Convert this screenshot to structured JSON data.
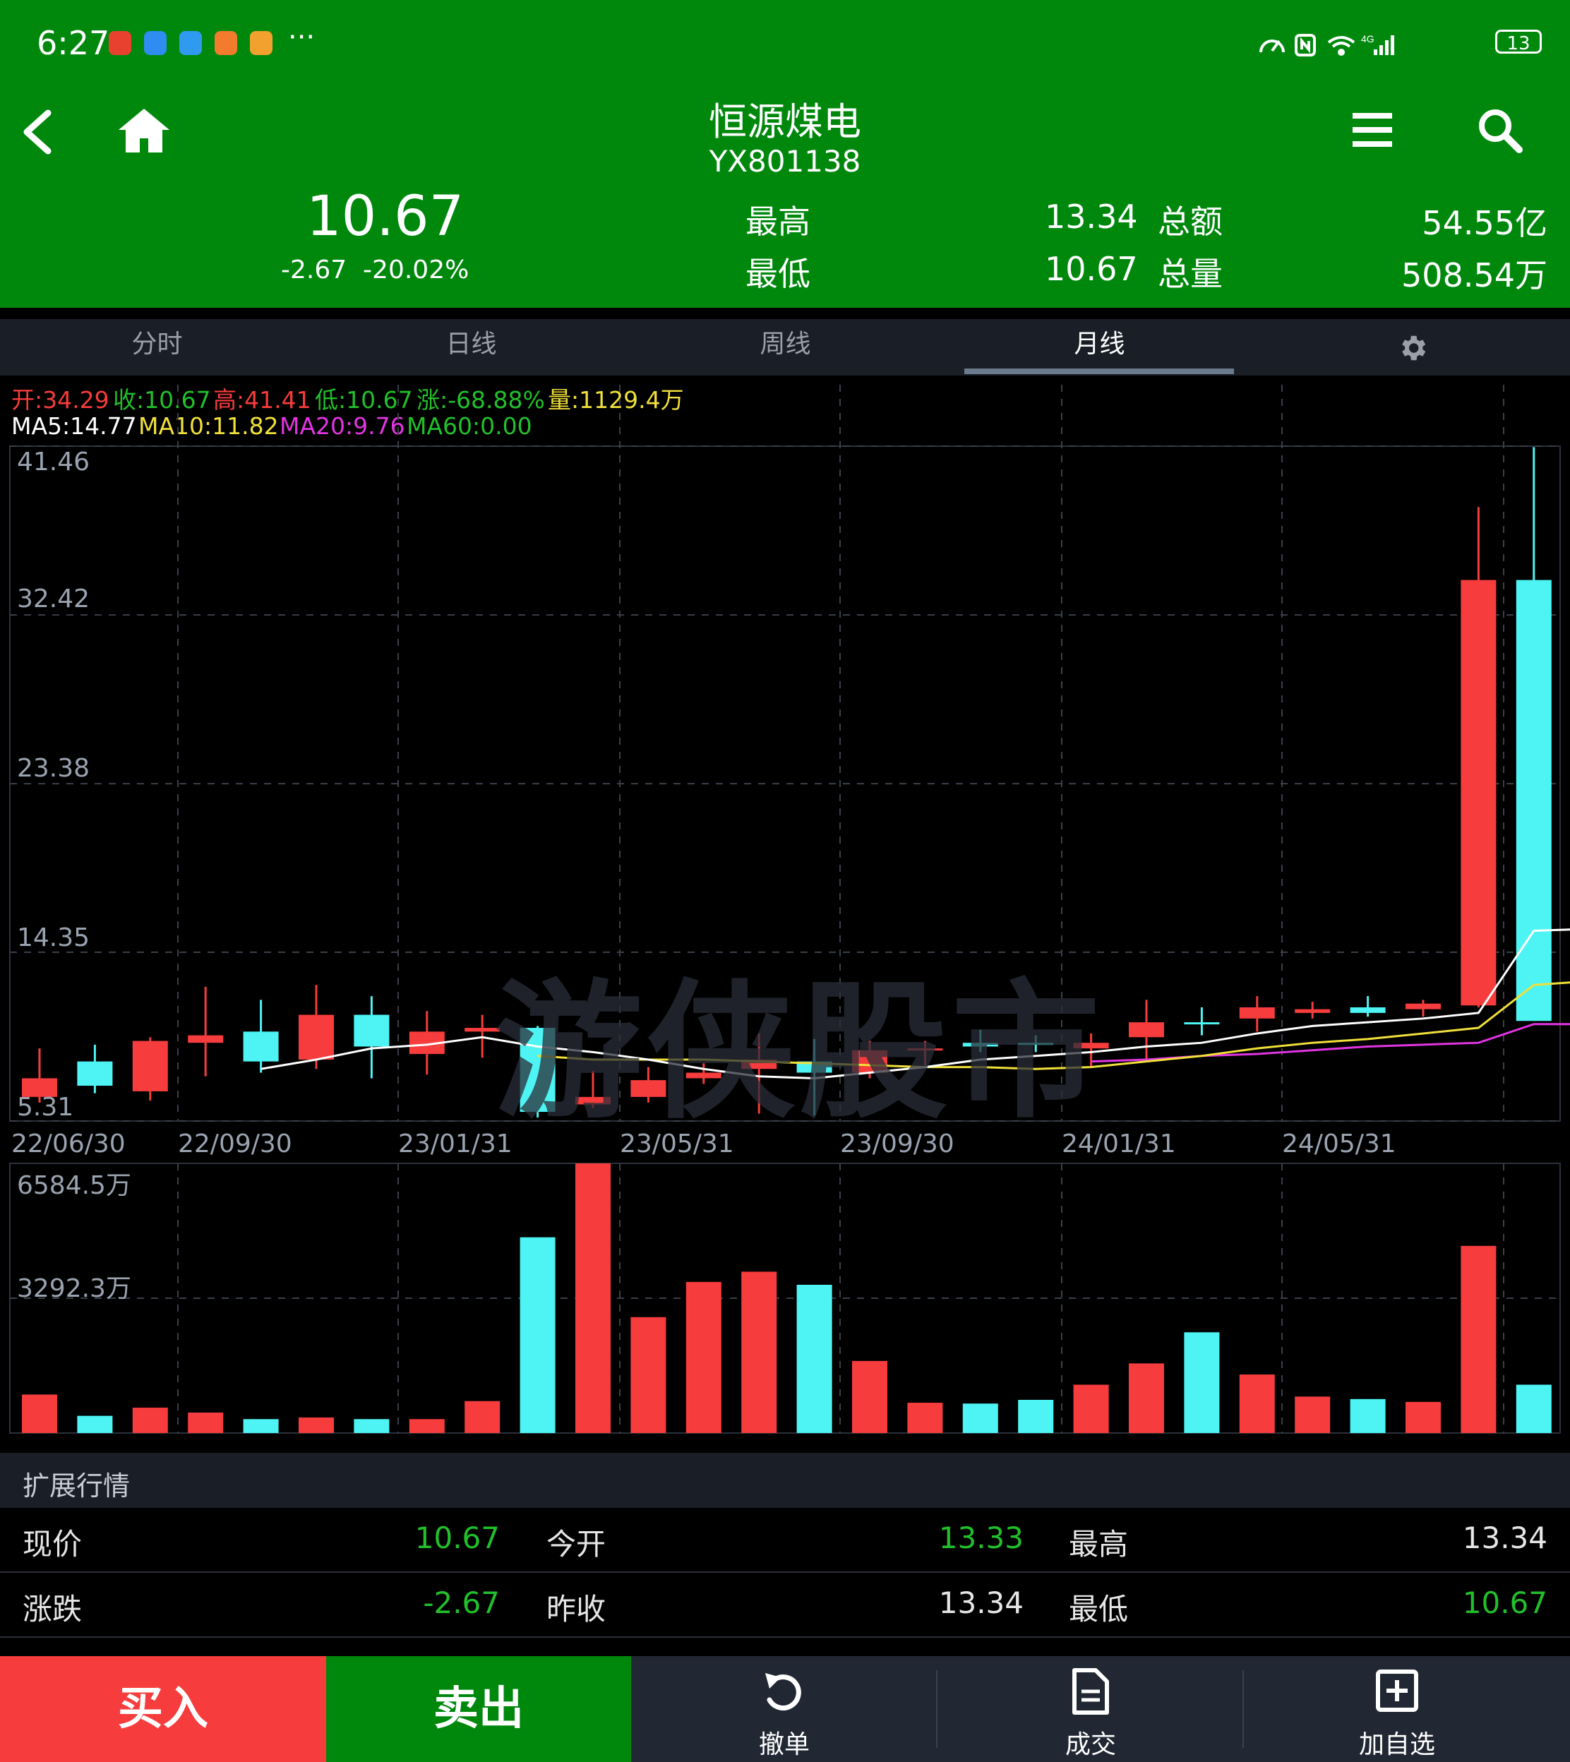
{
  "status_bar": {
    "time": "6:27",
    "more": "···",
    "network_label": "4G",
    "battery": "13"
  },
  "header": {
    "title": "恒源煤电",
    "code": "YX801138",
    "price": "10.67",
    "change": "-2.67",
    "change_pct": "-20.02%",
    "high_label": "最高",
    "high_value": "13.34",
    "low_label": "最低",
    "low_value": "10.67",
    "amount_label": "总额",
    "amount_value": "54.55亿",
    "volume_label": "总量",
    "volume_value": "508.54万"
  },
  "tabs": [
    "分时",
    "日线",
    "周线",
    "月线"
  ],
  "active_tab": "月线",
  "info": {
    "open": "开:34.29",
    "close": "收:10.67",
    "high": "高:41.41",
    "low": "低:10.67",
    "change": "涨:-68.88%",
    "volume": "量:1129.4万",
    "ma5": "MA5:14.77",
    "ma10": "MA10:11.82",
    "ma20": "MA20:9.76",
    "ma60": "MA60:0.00"
  },
  "watermark": "游侠股市",
  "colors": {
    "up": "#f63c3c",
    "down": "#4ef4f4",
    "ma5": "#ffffff",
    "ma10": "#f0e03a",
    "ma20": "#e235e2",
    "ma60": "#22c02a",
    "header_bg": "#00880d",
    "value_green": "#22c02a"
  },
  "chart_data": [
    {
      "type": "candlestick",
      "title": "",
      "period": "月线",
      "y_ticks": [
        "41.46",
        "32.42",
        "23.38",
        "14.35",
        "5.31"
      ],
      "ylim": [
        5.31,
        41.46
      ],
      "x_tick_labels": [
        "22/06/30",
        "22/09/30",
        "23/01/31",
        "23/05/31",
        "23/09/30",
        "24/01/31",
        "24/05/31"
      ],
      "candles": [
        {
          "o": 6.6,
          "c": 7.6,
          "h": 9.2,
          "l": 6.3
        },
        {
          "o": 8.5,
          "c": 7.2,
          "h": 9.4,
          "l": 6.8
        },
        {
          "o": 6.9,
          "c": 9.6,
          "h": 9.8,
          "l": 6.4
        },
        {
          "o": 9.5,
          "c": 9.9,
          "h": 12.5,
          "l": 7.7
        },
        {
          "o": 10.1,
          "c": 8.5,
          "h": 11.8,
          "l": 7.9
        },
        {
          "o": 8.6,
          "c": 11.0,
          "h": 12.6,
          "l": 8.1
        },
        {
          "o": 11.0,
          "c": 9.3,
          "h": 12.0,
          "l": 7.6
        },
        {
          "o": 8.9,
          "c": 10.1,
          "h": 11.2,
          "l": 7.8
        },
        {
          "o": 10.1,
          "c": 10.3,
          "h": 11.0,
          "l": 8.7
        },
        {
          "o": 10.3,
          "c": 5.8,
          "h": 10.4,
          "l": 5.5
        },
        {
          "o": 6.2,
          "c": 6.6,
          "h": 8.0,
          "l": 6.0
        },
        {
          "o": 6.6,
          "c": 7.5,
          "h": 8.2,
          "l": 6.3
        },
        {
          "o": 7.6,
          "c": 7.9,
          "h": 8.4,
          "l": 7.3
        },
        {
          "o": 8.1,
          "c": 8.6,
          "h": 10.0,
          "l": 5.7
        },
        {
          "o": 8.5,
          "c": 7.9,
          "h": 9.7,
          "l": 5.6
        },
        {
          "o": 7.9,
          "c": 9.1,
          "h": 9.6,
          "l": 7.6
        },
        {
          "o": 9.1,
          "c": 9.2,
          "h": 9.6,
          "l": 8.3
        },
        {
          "o": 9.5,
          "c": 9.3,
          "h": 10.2,
          "l": 9.0
        },
        {
          "o": 9.5,
          "c": 9.4,
          "h": 9.9,
          "l": 9.0
        },
        {
          "o": 9.2,
          "c": 9.5,
          "h": 10.0,
          "l": 8.2
        },
        {
          "o": 9.8,
          "c": 10.6,
          "h": 11.8,
          "l": 8.6
        },
        {
          "o": 10.6,
          "c": 10.5,
          "h": 11.4,
          "l": 9.9
        },
        {
          "o": 10.8,
          "c": 11.4,
          "h": 12.0,
          "l": 10.1
        },
        {
          "o": 11.1,
          "c": 11.3,
          "h": 11.7,
          "l": 10.8
        },
        {
          "o": 11.4,
          "c": 11.1,
          "h": 12.0,
          "l": 10.9
        },
        {
          "o": 11.3,
          "c": 11.6,
          "h": 11.8,
          "l": 10.9
        },
        {
          "o": 11.5,
          "c": 34.29,
          "h": 38.2,
          "l": 11.4
        },
        {
          "o": 34.29,
          "c": 10.67,
          "h": 41.41,
          "l": 10.67
        }
      ],
      "ma5": [
        null,
        null,
        null,
        null,
        8.1,
        8.6,
        9.2,
        9.4,
        9.8,
        9.3,
        9.0,
        8.6,
        8.1,
        7.7,
        7.6,
        7.9,
        8.2,
        8.6,
        8.8,
        9.0,
        9.3,
        9.5,
        10.0,
        10.4,
        10.6,
        10.8,
        11.1,
        15.5,
        15.6
      ],
      "ma10": [
        null,
        null,
        null,
        null,
        null,
        null,
        null,
        null,
        null,
        8.8,
        8.6,
        8.6,
        8.6,
        8.5,
        8.4,
        8.3,
        8.2,
        8.2,
        8.1,
        8.2,
        8.5,
        8.8,
        9.2,
        9.5,
        9.7,
        10.0,
        10.3,
        12.6,
        12.8
      ],
      "ma20": [
        null,
        null,
        null,
        null,
        null,
        null,
        null,
        null,
        null,
        null,
        null,
        null,
        null,
        null,
        null,
        null,
        null,
        null,
        null,
        8.5,
        8.6,
        8.8,
        8.9,
        9.1,
        9.3,
        9.4,
        9.5,
        10.5,
        10.5
      ],
      "volume": {
        "y_ticks": [
          "6584.5万",
          "3292.3万"
        ],
        "ylim": [
          0,
          6584.5
        ],
        "unit": "万",
        "values": [
          940,
          420,
          620,
          500,
          340,
          380,
          340,
          340,
          780,
          4780,
          6584.5,
          2830,
          3690,
          3940,
          3620,
          1760,
          740,
          720,
          810,
          1180,
          1700,
          2460,
          1430,
          890,
          830,
          760,
          4570,
          1180
        ]
      }
    }
  ],
  "extended": {
    "title": "扩展行情",
    "rows": [
      [
        {
          "label": "现价",
          "value": "10.67",
          "color": "green"
        },
        {
          "label": "今开",
          "value": "13.33",
          "color": "green"
        },
        {
          "label": "最高",
          "value": "13.34",
          "color": "white"
        }
      ],
      [
        {
          "label": "涨跌",
          "value": "-2.67",
          "color": "green"
        },
        {
          "label": "昨收",
          "value": "13.34",
          "color": "white"
        },
        {
          "label": "最低",
          "value": "10.67",
          "color": "green"
        }
      ]
    ]
  },
  "bottom_bar": {
    "buy": "买入",
    "sell": "卖出",
    "cancel": "撤单",
    "deals": "成交",
    "add_watch": "加自选"
  }
}
